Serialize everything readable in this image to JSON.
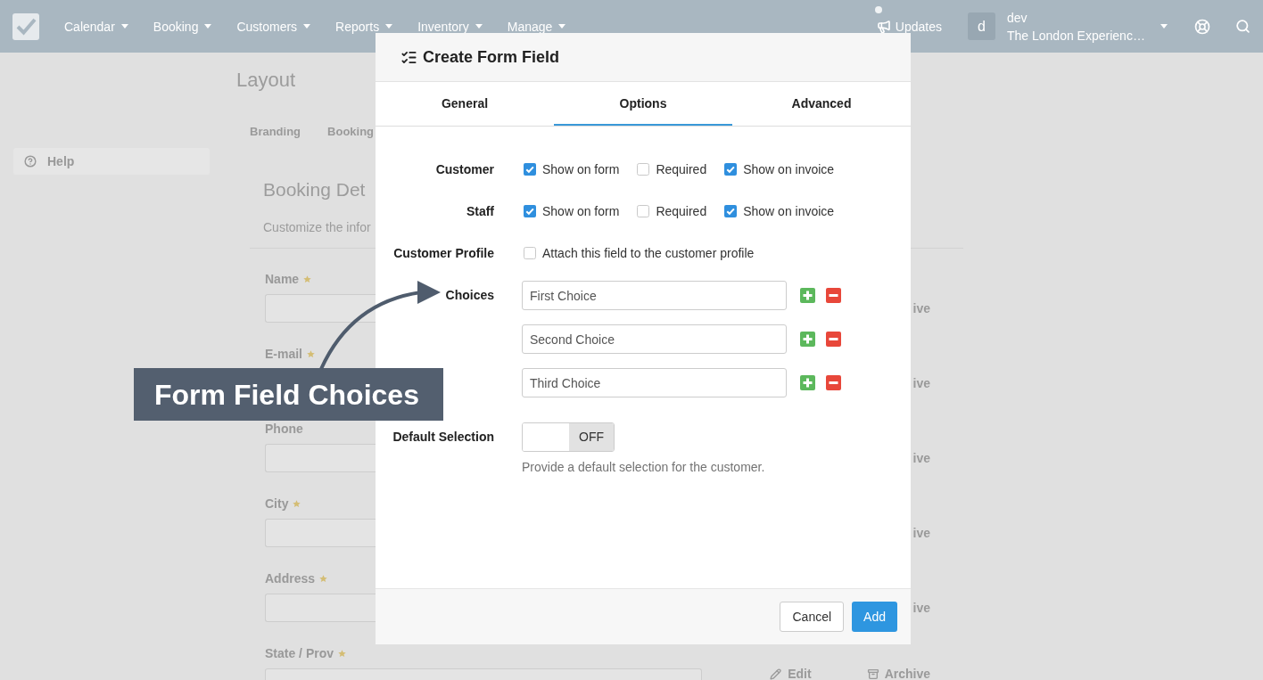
{
  "nav": {
    "menu": [
      {
        "label": "Calendar"
      },
      {
        "label": "Booking"
      },
      {
        "label": "Customers"
      },
      {
        "label": "Reports"
      },
      {
        "label": "Inventory"
      },
      {
        "label": "Manage"
      }
    ],
    "updates": {
      "label": "Updates",
      "unread": true
    },
    "account": {
      "avatar": "d",
      "name": "dev",
      "company": "The London Experienc…"
    }
  },
  "sidebar": {
    "items": [
      {
        "label": "Help"
      }
    ]
  },
  "page": {
    "title": "Layout",
    "tabs": [
      {
        "label": "Branding"
      },
      {
        "label": "Booking"
      }
    ],
    "section": {
      "title": "Booking Det",
      "description": "Customize the infor"
    },
    "fields": [
      {
        "label": "Name",
        "required": true,
        "input": true,
        "cut_off": true,
        "actions": [
          {
            "kind": "text",
            "label": "ive"
          }
        ]
      },
      {
        "label": "E-mail",
        "required": true,
        "input": false,
        "actions": [
          {
            "kind": "text",
            "label": "ive"
          }
        ]
      },
      {
        "label": "Phone",
        "required": false,
        "input": true,
        "cut_off": true,
        "actions": [
          {
            "kind": "text",
            "label": "ive"
          }
        ]
      },
      {
        "label": "City",
        "required": true,
        "input": true,
        "cut_off": true,
        "actions": [
          {
            "kind": "text",
            "label": "ive"
          }
        ]
      },
      {
        "label": "Address",
        "required": true,
        "input": true,
        "cut_off": true,
        "actions": [
          {
            "kind": "text",
            "label": "ive"
          }
        ]
      },
      {
        "label": "State / Prov",
        "required": true,
        "input": true,
        "cut_off": false,
        "actions": [
          {
            "kind": "edit",
            "label": "Edit"
          },
          {
            "kind": "archive",
            "label": "Archive"
          }
        ]
      }
    ]
  },
  "modal": {
    "title": "Create Form Field",
    "tabs": [
      {
        "label": "General",
        "selected": false
      },
      {
        "label": "Options",
        "selected": true
      },
      {
        "label": "Advanced",
        "selected": false
      }
    ],
    "rows": [
      {
        "kind": "checkboxes",
        "label": "Customer",
        "options": [
          {
            "label": "Show on form",
            "checked": true
          },
          {
            "label": "Required",
            "checked": false
          },
          {
            "label": "Show on invoice",
            "checked": true
          }
        ]
      },
      {
        "kind": "checkboxes",
        "label": "Staff",
        "options": [
          {
            "label": "Show on form",
            "checked": true
          },
          {
            "label": "Required",
            "checked": false
          },
          {
            "label": "Show on invoice",
            "checked": true
          }
        ]
      },
      {
        "kind": "checkboxes",
        "label": "Customer Profile",
        "options": [
          {
            "label": "Attach this field to the customer profile",
            "checked": false
          }
        ]
      },
      {
        "kind": "choices",
        "label": "Choices",
        "choices": [
          {
            "value": "First Choice"
          },
          {
            "value": "Second Choice"
          },
          {
            "value": "Third Choice"
          }
        ]
      },
      {
        "kind": "toggle",
        "label": "Default Selection",
        "toggle": {
          "on": false,
          "label": "OFF"
        },
        "help": "Provide a default selection for the customer."
      }
    ],
    "buttons": [
      {
        "kind": "secondary",
        "label": "Cancel"
      },
      {
        "kind": "primary",
        "label": "Add"
      }
    ]
  },
  "callout": {
    "text": "Form Field Choices"
  }
}
